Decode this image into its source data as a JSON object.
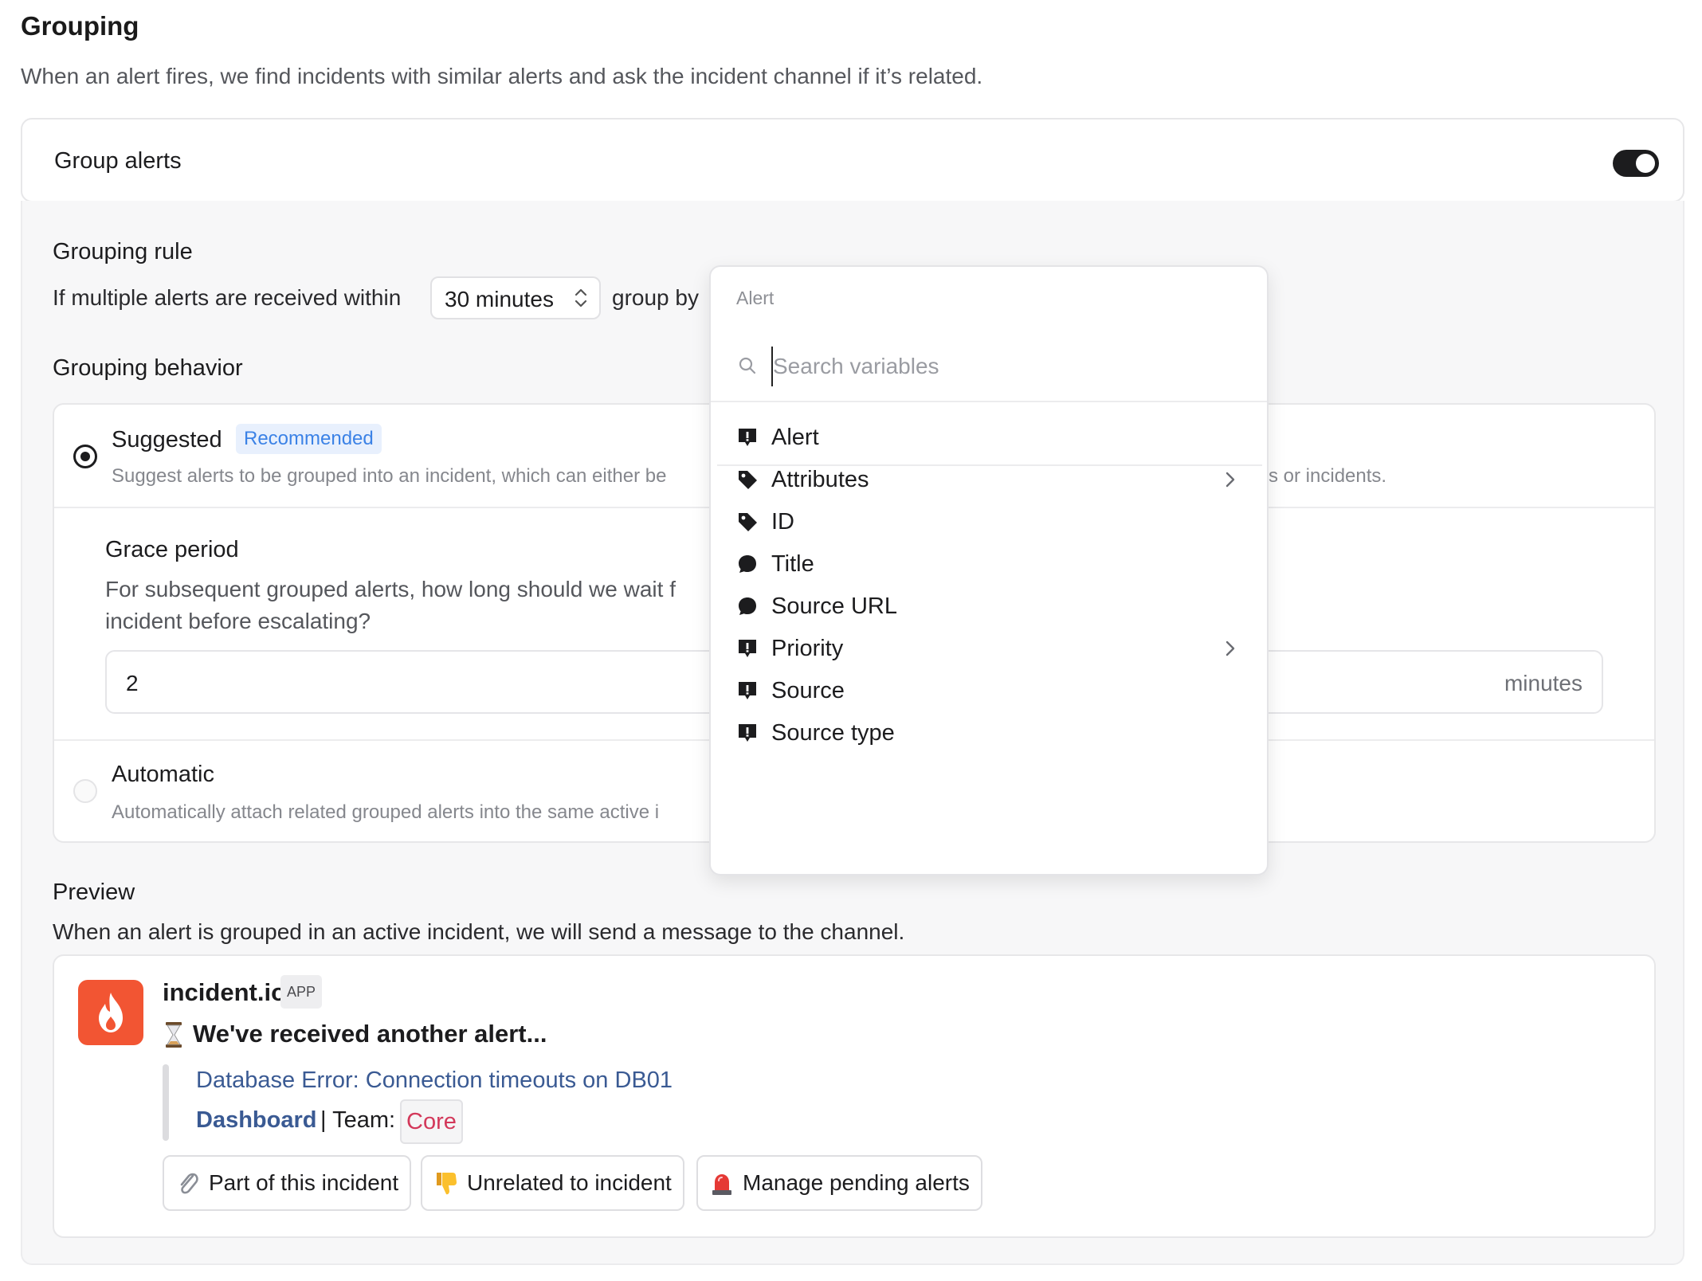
{
  "header": {
    "title": "Grouping",
    "subtitle": "When an alert fires, we find incidents with similar alerts and ask the incident channel if it’s related."
  },
  "group_alerts": {
    "label": "Group alerts",
    "enabled": true
  },
  "grouping_rule": {
    "heading": "Grouping rule",
    "prefix": "If multiple alerts are received within",
    "window_value": "30 minutes",
    "group_by_label": "group by"
  },
  "grouping_behavior": {
    "heading": "Grouping behavior",
    "suggested": {
      "title": "Suggested",
      "badge": "Recommended",
      "description_left": "Suggest alerts to be grouped into an incident, which can either be",
      "description_right": "s or incidents.",
      "selected": true
    },
    "grace_period": {
      "title": "Grace period",
      "description_line1": "For subsequent grouped alerts, how long should we wait f",
      "description_line2": "incident before escalating?",
      "value": "2",
      "unit": "minutes"
    },
    "automatic": {
      "title": "Automatic",
      "description": "Automatically attach related grouped alerts into the same active i",
      "selected": false
    }
  },
  "preview": {
    "heading": "Preview",
    "description": "When an alert is grouped in an active incident, we will send a message to the channel.",
    "message": {
      "app_name": "incident.io",
      "app_tag": "APP",
      "headline": "We've received another alert...",
      "alert_title": "Database Error: Connection timeouts on DB01",
      "dashboard_link": "Dashboard",
      "team_label": "| Team:",
      "team_value": "Core",
      "actions": [
        {
          "label": "Part of this incident",
          "icon": "paperclip-icon"
        },
        {
          "label": "Unrelated to incident",
          "icon": "thumbs-down-icon"
        },
        {
          "label": "Manage pending alerts",
          "icon": "siren-icon"
        }
      ]
    }
  },
  "variable_dropdown": {
    "header": "Alert",
    "search_placeholder": "Search variables",
    "items": [
      {
        "label": "Alert",
        "icon": "alert-icon",
        "has_submenu": false
      },
      {
        "label": "Attributes",
        "icon": "tag-icon",
        "has_submenu": true
      },
      {
        "label": "ID",
        "icon": "tag-icon",
        "has_submenu": false
      },
      {
        "label": "Title",
        "icon": "speech-bubble-icon",
        "has_submenu": false
      },
      {
        "label": "Source URL",
        "icon": "speech-bubble-icon",
        "has_submenu": false
      },
      {
        "label": "Priority",
        "icon": "alert-icon",
        "has_submenu": true
      },
      {
        "label": "Source",
        "icon": "alert-icon",
        "has_submenu": false
      },
      {
        "label": "Source type",
        "icon": "alert-icon",
        "has_submenu": false
      }
    ]
  },
  "colors": {
    "accent_badge_bg": "#e8f0fd",
    "accent_badge_text": "#3b82e6",
    "brand": "#f25533",
    "link": "#3a5a93",
    "team_chip_text": "#d3385a"
  }
}
